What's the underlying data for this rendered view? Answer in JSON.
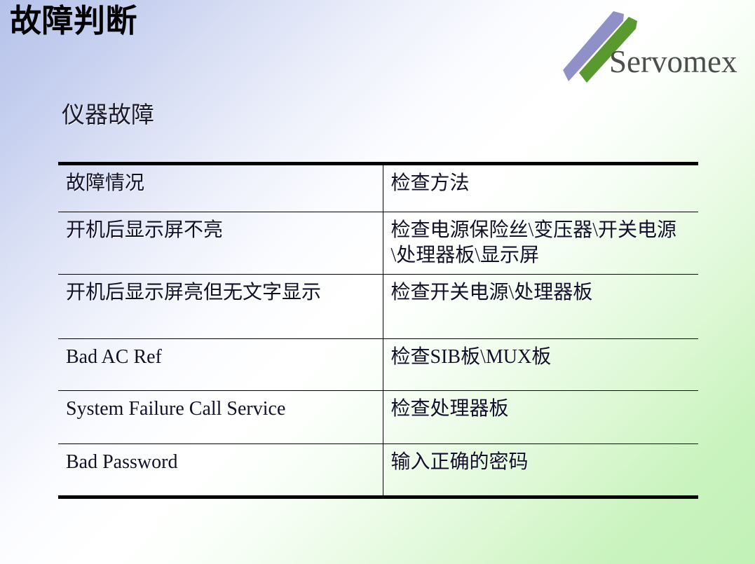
{
  "slide": {
    "title": "故障判断",
    "section_heading": "仪器故障"
  },
  "logo": {
    "wordmark": "Servomex",
    "stroke_purple": "#8f90c8",
    "stroke_green": "#5a9930",
    "wordmark_color": "#4d4d4d"
  },
  "theme": {
    "background_top_left": "#b6c2ea",
    "background_middle": "#ffffff",
    "background_bottom_right": "#c1f2b6",
    "rule_color": "#000000",
    "text_color": "#101028"
  },
  "table": {
    "headers": [
      "故障情况",
      "检查方法"
    ],
    "rows": [
      {
        "fault": "开机后显示屏不亮",
        "check": "检查电源保险丝\\变压器\\开关电源\\处理器板\\显示屏"
      },
      {
        "fault": "开机后显示屏亮但无文字显示",
        "check": "检查开关电源\\处理器板"
      },
      {
        "fault": "Bad AC Ref",
        "check": "检查SIB板\\MUX板"
      },
      {
        "fault": "System Failure Call Service",
        "check": "检查处理器板"
      },
      {
        "fault": "Bad Password",
        "check": "输入正确的密码"
      }
    ]
  }
}
